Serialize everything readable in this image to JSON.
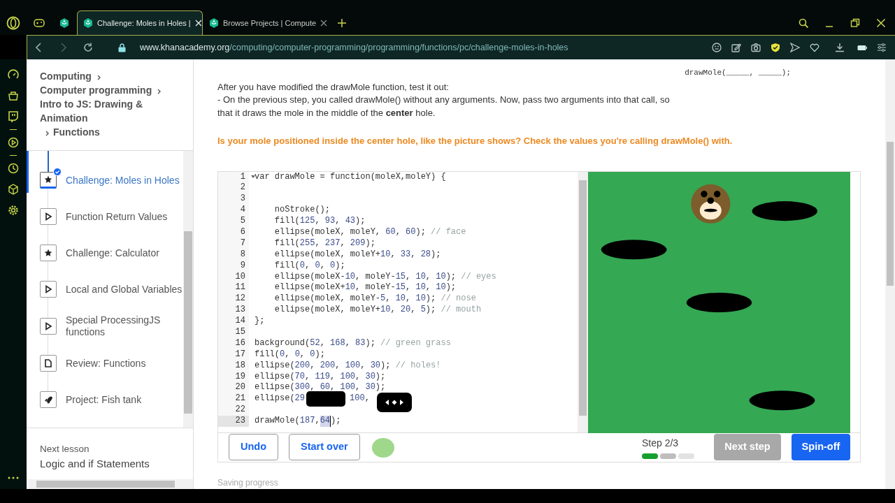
{
  "browser": {
    "tabs": [
      {
        "title": "Challenge: Moles in Holes |",
        "selected": true
      },
      {
        "title": "Browse Projects | Compute",
        "selected": false
      }
    ],
    "url": {
      "host": "www.khanacademy.org",
      "path": "/computing/computer-programming/programming/functions/pc/challenge-moles-in-holes"
    }
  },
  "sidebar": {
    "breadcrumb": [
      "Computing",
      "Computer programming",
      "Intro to JS: Drawing & Animation",
      "Functions"
    ],
    "items": [
      {
        "title": "Challenge: Moles in Holes",
        "kind": "star",
        "selected": true,
        "completed": true
      },
      {
        "title": "Function Return Values",
        "kind": "play",
        "selected": false,
        "completed": false
      },
      {
        "title": "Challenge: Calculator",
        "kind": "star",
        "selected": false,
        "completed": false
      },
      {
        "title": "Local and Global Variables",
        "kind": "play",
        "selected": false,
        "completed": false
      },
      {
        "title": "Special ProcessingJS functions",
        "kind": "play",
        "selected": false,
        "completed": false
      },
      {
        "title": "Review: Functions",
        "kind": "doc",
        "selected": false,
        "completed": false
      },
      {
        "title": "Project: Fish tank",
        "kind": "rocket",
        "selected": false,
        "completed": false
      }
    ],
    "next_lesson": {
      "label": "Next lesson",
      "title": "Logic and if Statements"
    }
  },
  "content": {
    "snippet": "drawMole(_____, _____);",
    "instructions": [
      "After you have modified the drawMole function, test it out:",
      "- On the previous step, you called drawMole() without any arguments. Now, pass two arguments into that call, so that it draws the mole in the middle of the **center** hole."
    ],
    "hint": "Is your mole positioned inside the center hole, like the picture shows? Check the values you're calling drawMole() with."
  },
  "editor": {
    "lines": [
      {
        "number": "1",
        "text": "var drawMole = function(moleX,moleY) {",
        "fold": true,
        "active": false
      },
      {
        "number": "2",
        "fold": false,
        "active": false
      },
      {
        "number": "3",
        "fold": false,
        "active": false
      },
      {
        "number": "4",
        "text": "    noStroke();",
        "fold": false,
        "active": false
      },
      {
        "number": "5",
        "text": "    fill(125, 93, 43);",
        "fold": false,
        "active": false
      },
      {
        "number": "6",
        "text": "    ellipse(moleX, moleY, 60, 60); // face",
        "fold": false,
        "active": false
      },
      {
        "number": "7",
        "text": "    fill(255, 237, 209);",
        "fold": false,
        "active": false
      },
      {
        "number": "8",
        "text": "    ellipse(moleX, moleY+10, 33, 28);",
        "fold": false,
        "active": false
      },
      {
        "number": "9",
        "text": "    fill(0, 0, 0);",
        "fold": false,
        "active": false
      },
      {
        "number": "10",
        "text": "    ellipse(moleX-10, moleY-15, 10, 10); // eyes",
        "fold": false,
        "active": false
      },
      {
        "number": "11",
        "text": "    ellipse(moleX+10, moleY-15, 10, 10);",
        "fold": false,
        "active": false
      },
      {
        "number": "12",
        "text": "    ellipse(moleX, moleY-5, 10, 10); // nose",
        "fold": false,
        "active": false
      },
      {
        "number": "13",
        "text": "    ellipse(moleX, moleY+10, 20, 5); // mouth",
        "fold": false,
        "active": false
      },
      {
        "number": "14",
        "text": "};",
        "fold": false,
        "active": false
      },
      {
        "number": "15",
        "fold": false,
        "active": false
      },
      {
        "number": "16",
        "text": "background(52, 168, 83); // green grass",
        "fold": false,
        "active": false
      },
      {
        "number": "17",
        "text": "fill(0, 0, 0);",
        "fold": false,
        "active": false
      },
      {
        "number": "18",
        "text": "ellipse(200, 200, 100, 30); // holes!",
        "fold": false,
        "active": false
      },
      {
        "number": "19",
        "text": "ellipse(70, 119, 100, 30);",
        "fold": false,
        "active": false
      },
      {
        "number": "20",
        "text": "ellipse(300, 60, 100, 30);",
        "fold": false,
        "active": false
      },
      {
        "number": "21",
        "text": "ellipse(29",
        "covered": true,
        "text_after": "100,",
        "fold": false,
        "active": false
      },
      {
        "number": "22",
        "fold": false,
        "active": false
      },
      {
        "number": "23",
        "text": "drawMole(187,",
        "selected_text": "64",
        "text_after": ");",
        "fold": false,
        "active": true
      }
    ]
  },
  "footer": {
    "undo": "Undo",
    "start_over": "Start over",
    "step": "Step 2/3",
    "progress": [
      {
        "done": true,
        "current": false
      },
      {
        "done": false,
        "current": true
      },
      {
        "done": false,
        "current": false
      }
    ],
    "next_step": {
      "label": "Next step",
      "disabled": true
    },
    "spin_off": "Spin-off"
  },
  "status": "Saving progress"
}
